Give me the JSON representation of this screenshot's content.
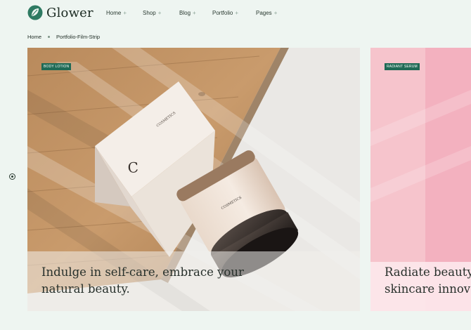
{
  "brand": {
    "name": "Glower",
    "logo_icon": "leaf-logo-icon",
    "accent": "#1f6a55"
  },
  "nav": {
    "items": [
      {
        "label": "Home",
        "plus": "+"
      },
      {
        "label": "Shop",
        "plus": "+"
      },
      {
        "label": "Blog",
        "plus": "+"
      },
      {
        "label": "Portfolio",
        "plus": "+"
      },
      {
        "label": "Pages",
        "plus": "+"
      }
    ]
  },
  "breadcrumb": {
    "home": "Home",
    "current": "Portfolio-Film-Strip"
  },
  "slides": [
    {
      "tag": "BODY LOTION",
      "caption_line1": "Indulge in self-care, embrace your",
      "caption_line2": "natural beauty.",
      "box_brand": "COSMETICS",
      "box_letter": "C"
    },
    {
      "tag": "RADIANT SERUM",
      "caption_line1": "Radiate beauty t",
      "caption_line2": "skincare innovat"
    }
  ]
}
